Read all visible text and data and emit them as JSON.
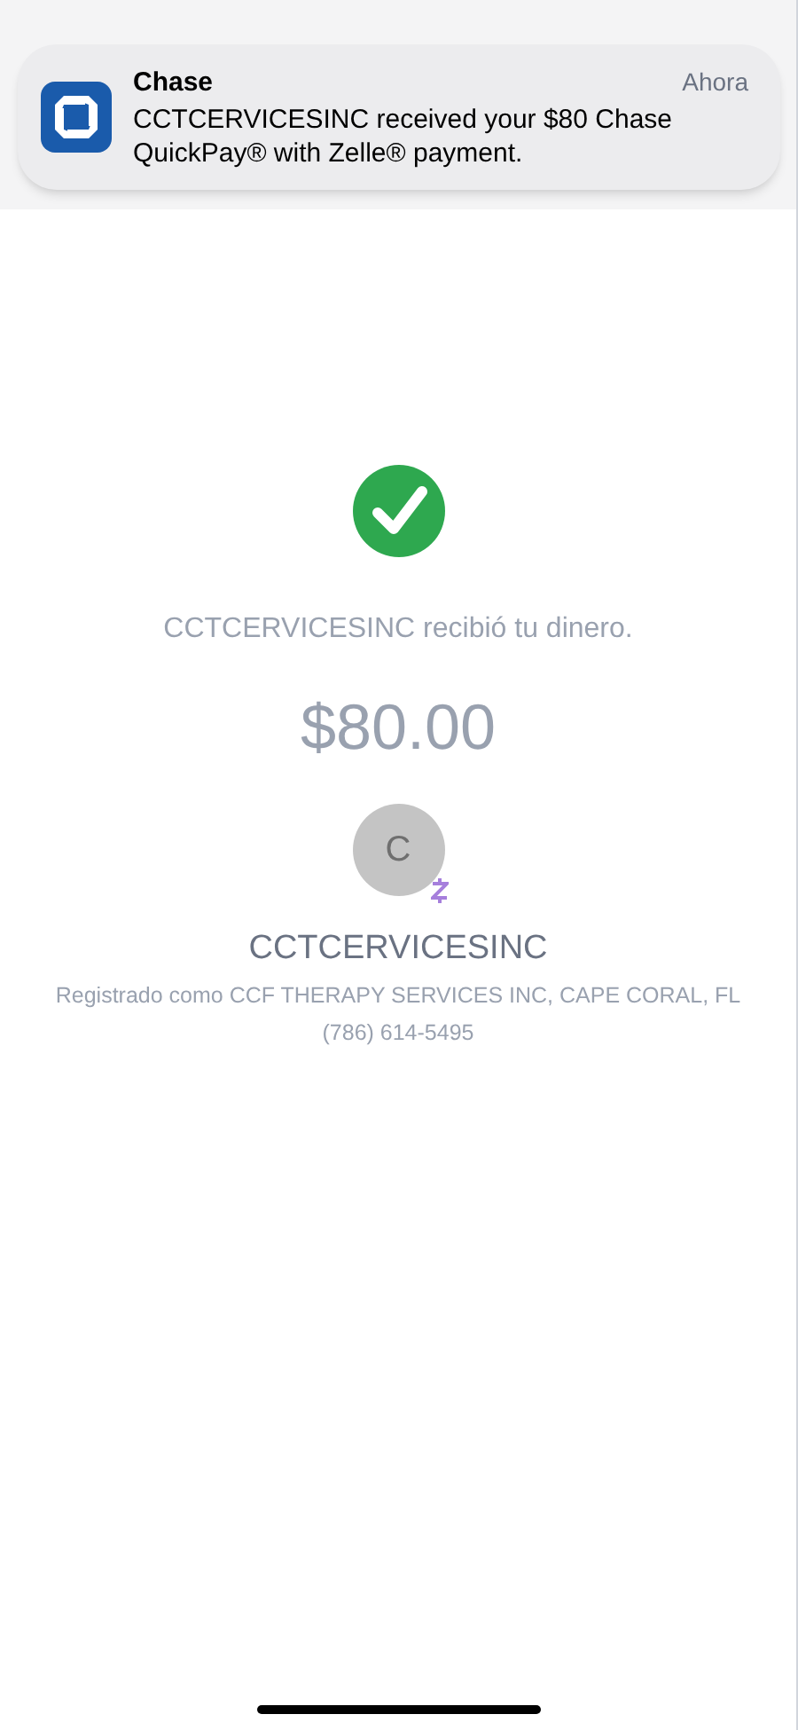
{
  "notification": {
    "app": "Chase",
    "time": "Ahora",
    "message": "CCTCERVICESINC received your $80 Chase QuickPay® with Zelle® payment."
  },
  "confirmation": {
    "message": "CCTCERVICESINC recibió tu dinero.",
    "amount": "$80.00"
  },
  "recipient": {
    "initial": "C",
    "name": "CCTCERVICESINC",
    "registered": "Registrado como CCF THERAPY SERVICES INC, CAPE CORAL, FL",
    "phone": "(786) 614-5495"
  }
}
